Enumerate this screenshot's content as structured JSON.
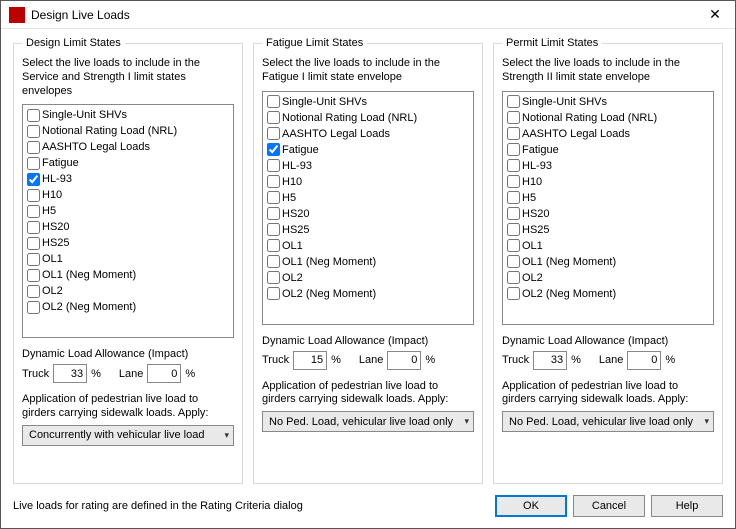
{
  "window": {
    "title": "Design Live Loads"
  },
  "labels": {
    "dla_header": "Dynamic Load Allowance (Impact)",
    "truck": "Truck",
    "lane": "Lane",
    "pct": "%",
    "ped_header": "Application of pedestrian live load to girders carrying sidewalk loads. Apply:"
  },
  "groups": [
    {
      "legend": "Design Limit States",
      "instr": "Select the live loads to include in the Service and Strength I limit states envelopes",
      "items": [
        {
          "label": "Single-Unit SHVs",
          "checked": false
        },
        {
          "label": "Notional Rating Load (NRL)",
          "checked": false
        },
        {
          "label": "AASHTO Legal Loads",
          "checked": false
        },
        {
          "label": "Fatigue",
          "checked": false
        },
        {
          "label": "HL-93",
          "checked": true
        },
        {
          "label": "H10",
          "checked": false
        },
        {
          "label": "H5",
          "checked": false
        },
        {
          "label": "HS20",
          "checked": false
        },
        {
          "label": "HS25",
          "checked": false
        },
        {
          "label": "OL1",
          "checked": false
        },
        {
          "label": "OL1 (Neg Moment)",
          "checked": false
        },
        {
          "label": "OL2",
          "checked": false
        },
        {
          "label": "OL2 (Neg Moment)",
          "checked": false
        }
      ],
      "truck": "33",
      "lane": "0",
      "combo": "Concurrently with vehicular live load"
    },
    {
      "legend": "Fatigue Limit States",
      "instr": "Select the live loads to include in the Fatigue I limit state envelope",
      "items": [
        {
          "label": "Single-Unit SHVs",
          "checked": false
        },
        {
          "label": "Notional Rating Load (NRL)",
          "checked": false
        },
        {
          "label": "AASHTO Legal Loads",
          "checked": false
        },
        {
          "label": "Fatigue",
          "checked": true
        },
        {
          "label": "HL-93",
          "checked": false
        },
        {
          "label": "H10",
          "checked": false
        },
        {
          "label": "H5",
          "checked": false
        },
        {
          "label": "HS20",
          "checked": false
        },
        {
          "label": "HS25",
          "checked": false
        },
        {
          "label": "OL1",
          "checked": false
        },
        {
          "label": "OL1 (Neg Moment)",
          "checked": false
        },
        {
          "label": "OL2",
          "checked": false
        },
        {
          "label": "OL2 (Neg Moment)",
          "checked": false
        }
      ],
      "truck": "15",
      "lane": "0",
      "combo": "No Ped. Load, vehicular live load only"
    },
    {
      "legend": "Permit Limit States",
      "instr": "Select the live loads to include in the Strength II limit state envelope",
      "items": [
        {
          "label": "Single-Unit SHVs",
          "checked": false
        },
        {
          "label": "Notional Rating Load (NRL)",
          "checked": false
        },
        {
          "label": "AASHTO Legal Loads",
          "checked": false
        },
        {
          "label": "Fatigue",
          "checked": false
        },
        {
          "label": "HL-93",
          "checked": false
        },
        {
          "label": "H10",
          "checked": false
        },
        {
          "label": "H5",
          "checked": false
        },
        {
          "label": "HS20",
          "checked": false
        },
        {
          "label": "HS25",
          "checked": false
        },
        {
          "label": "OL1",
          "checked": false
        },
        {
          "label": "OL1 (Neg Moment)",
          "checked": false
        },
        {
          "label": "OL2",
          "checked": false
        },
        {
          "label": "OL2 (Neg Moment)",
          "checked": false
        }
      ],
      "truck": "33",
      "lane": "0",
      "combo": "No Ped. Load, vehicular live load only"
    }
  ],
  "footer": {
    "note": "Live loads for rating are defined in the Rating Criteria dialog",
    "ok": "OK",
    "cancel": "Cancel",
    "help": "Help"
  }
}
